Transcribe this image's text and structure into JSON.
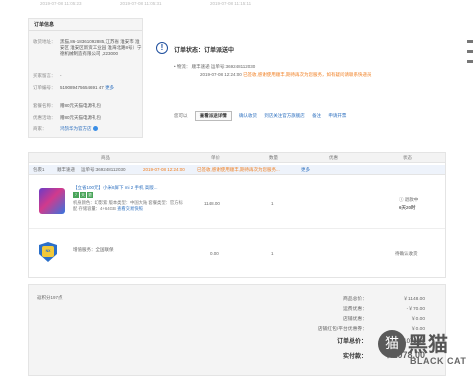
{
  "timestamps": [
    "2019-07-08 11:05:23",
    "2019-07-08 11:05:31",
    "2019-07-08 11:15:11"
  ],
  "order_info": {
    "title": "订单信息",
    "rows": [
      {
        "k": "收货地址：",
        "v": "黑猫,86-18361092885,江苏省 淮安市 淮安区 淮安区新资工业园 淮海北路8号）宁德机械制造有限公司 ,223000"
      },
      {
        "k": "买家留言：",
        "v": "-"
      },
      {
        "k": "订单编号：",
        "v": "519089475654691 47",
        "extra": "更多"
      },
      {
        "k": "套餐名称：",
        "v": "赠80元天猫电源礼包"
      },
      {
        "k": "优惠活动：",
        "v": "赠80元天猫电源礼包"
      },
      {
        "k": "商家：",
        "v": "鸿鹄华为官方店"
      }
    ]
  },
  "status": {
    "title": "订单状态：订单派送中",
    "logistics_label": "• 物流：",
    "carrier": "顺丰速递",
    "tracking": "运单号:369248112030",
    "time": "2019-07-08 12:24:00",
    "message": "已签收,感谢使用顺丰,期待再次为您服务，如有疑问请联系快递员",
    "actions_prefix": "您可以",
    "log_button": "查看派送详情",
    "actions": [
      "确认收货",
      "到店关注官方旗舰店",
      "备注",
      "申请开票"
    ]
  },
  "table": {
    "headers": [
      "商品",
      "单价",
      "数量",
      "优惠",
      "状态"
    ],
    "package": {
      "label": "包裹1",
      "carrier": "顺丰速递",
      "tracking": "运单号:369248112030",
      "time": "2019-07-08 12:24:00",
      "message": "已签收,感谢使用顺丰,期待再次为您服务...",
      "more": "更多"
    },
    "product": {
      "title": "【立省100元】小米8屏下 mi 2 手机 高版...",
      "badges": [
        "7",
        "天",
        "退"
      ],
      "meta": "机身颜色：幻影紫  版本类型：中国大陆  套餐类型：官方标配  存储容量：4+64GB",
      "extra": "查看交易快照",
      "price": "1148.00",
      "qty": "1",
      "status": "退款中",
      "status_sub": "6天20时"
    },
    "service": {
      "title": "增值服务：全国联保",
      "badge": "NX",
      "price": "0.00",
      "qty": "1",
      "status": "待确认收货"
    }
  },
  "summary": {
    "points_note": "返积分197点",
    "rows": [
      {
        "label": "商品总价：",
        "value": "￥1148.00"
      },
      {
        "label": "运费优惠：",
        "value": "-￥70.00"
      },
      {
        "label": "店铺优惠：",
        "value": "￥0.00"
      },
      {
        "label": "店铺红包/平台优惠券：",
        "value": "￥0.00"
      }
    ],
    "order_total_label": "订单总价：",
    "order_total_value": "￥1078.00",
    "paid_label": "实付款：",
    "paid_value": "￥1078.00"
  },
  "watermark": {
    "logo": "猫",
    "cn": "黑猫",
    "en": "BLACK CAT"
  }
}
